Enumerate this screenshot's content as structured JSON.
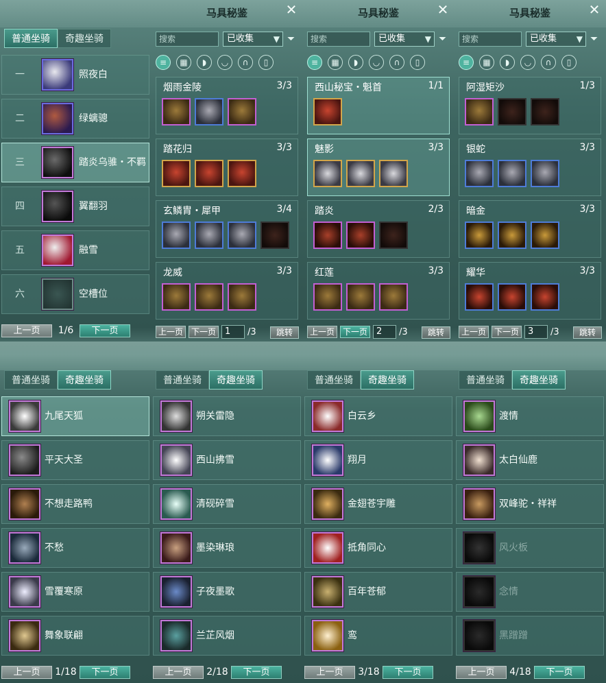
{
  "mount_tabs": {
    "normal": "普通坐骑",
    "fun": "奇趣坐骑"
  },
  "codex_title": "马具秘鉴",
  "search_placeholder": "搜索",
  "filter_option": "已收集",
  "prev_label": "上一页",
  "next_label": "下一页",
  "jump_label": "跳转",
  "slash": "/3",
  "normal_list": {
    "page": "1/6",
    "rows": [
      {
        "num": "一",
        "name": "照夜白"
      },
      {
        "num": "二",
        "name": "绿螭骢"
      },
      {
        "num": "三",
        "name": "踏炎乌骓・不羁"
      },
      {
        "num": "四",
        "name": "翼翻羽"
      },
      {
        "num": "五",
        "name": "融雪"
      },
      {
        "num": "六",
        "name": "空槽位"
      }
    ]
  },
  "codex_pages": [
    {
      "page": "1",
      "sets": [
        {
          "name": "烟雨金陵",
          "count": "3/3"
        },
        {
          "name": "踏花归",
          "count": "3/3"
        },
        {
          "name": "玄鳞胄・犀甲",
          "count": "3/4"
        },
        {
          "name": "龙威",
          "count": "3/3"
        }
      ]
    },
    {
      "page": "2",
      "sets": [
        {
          "name": "西山秘宝・魁首",
          "count": "1/1"
        },
        {
          "name": "魅影",
          "count": "3/3"
        },
        {
          "name": "踏炎",
          "count": "2/3"
        },
        {
          "name": "红莲",
          "count": "3/3"
        }
      ]
    },
    {
      "page": "3",
      "sets": [
        {
          "name": "阿湿矩沙",
          "count": "1/3"
        },
        {
          "name": "银蛇",
          "count": "3/3"
        },
        {
          "name": "暗金",
          "count": "3/3"
        },
        {
          "name": "耀华",
          "count": "3/3"
        }
      ]
    }
  ],
  "fun_pages": [
    {
      "page": "1/18",
      "mounts": [
        "九尾天狐",
        "平天大圣",
        "不想走路鸭",
        "不愁",
        "雪覆寒原",
        "舞象联翩"
      ]
    },
    {
      "page": "2/18",
      "mounts": [
        "朔关雷隐",
        "西山拂雪",
        "清砚碎雪",
        "墨染琳琅",
        "子夜墨歌",
        "兰芷风烟"
      ]
    },
    {
      "page": "3/18",
      "mounts": [
        "白云乡",
        "翔月",
        "金翅苍宇雕",
        "抵角同心",
        "百年苍郁",
        "鸾"
      ]
    },
    {
      "page": "4/18",
      "mounts": [
        "渡情",
        "太白仙鹿",
        "双峰驼・祥祥",
        "风火板",
        "念情",
        "黑蹭蹭"
      ]
    }
  ]
}
